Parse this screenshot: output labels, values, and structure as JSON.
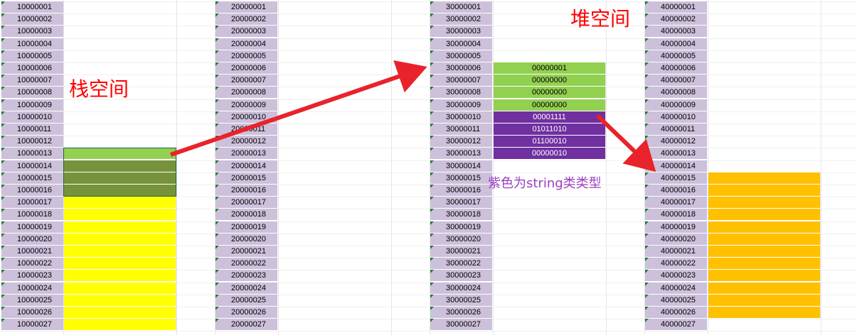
{
  "columns": [
    {
      "id": "stack-addr",
      "addresses": [
        "10000001",
        "10000002",
        "10000003",
        "10000004",
        "10000005",
        "10000006",
        "10000007",
        "10000008",
        "10000009",
        "10000010",
        "10000011",
        "10000012",
        "10000013",
        "10000014",
        "10000015",
        "10000016",
        "10000017",
        "10000018",
        "10000019",
        "10000020",
        "10000021",
        "10000022",
        "10000023",
        "10000024",
        "10000025",
        "10000026",
        "10000027"
      ]
    },
    {
      "id": "col2-addr",
      "addresses": [
        "20000001",
        "20000002",
        "20000003",
        "20000004",
        "20000005",
        "20000006",
        "20000007",
        "20000008",
        "20000009",
        "20000010",
        "20000011",
        "20000012",
        "20000013",
        "20000014",
        "20000015",
        "20000016",
        "20000017",
        "20000018",
        "20000019",
        "20000020",
        "20000021",
        "20000022",
        "20000023",
        "20000024",
        "20000025",
        "20000026",
        "20000027"
      ]
    },
    {
      "id": "heap-addr",
      "addresses": [
        "30000001",
        "30000002",
        "30000003",
        "30000004",
        "30000005",
        "30000006",
        "30000007",
        "30000008",
        "30000009",
        "30000010",
        "30000011",
        "30000012",
        "30000013",
        "30000014",
        "30000015",
        "30000016",
        "30000017",
        "30000018",
        "30000019",
        "30000020",
        "30000021",
        "30000022",
        "30000023",
        "30000024",
        "30000025",
        "30000026",
        "30000027"
      ]
    },
    {
      "id": "col4-addr",
      "addresses": [
        "40000001",
        "40000002",
        "40000003",
        "40000004",
        "40000005",
        "40000006",
        "40000007",
        "40000008",
        "40000009",
        "40000010",
        "40000011",
        "40000012",
        "40000013",
        "40000014",
        "40000015",
        "40000016",
        "40000017",
        "40000018",
        "40000019",
        "40000020",
        "40000021",
        "40000022",
        "40000023",
        "40000024",
        "40000025",
        "40000026",
        "40000027"
      ]
    }
  ],
  "heap_values": [
    "00000001",
    "00000000",
    "00000000",
    "00000000",
    "00001111",
    "01011010",
    "01100010",
    "00000010"
  ],
  "labels": {
    "stack": "栈空间",
    "heap": "堆空间",
    "purple_note": "紫色为string类类型"
  },
  "colors": {
    "addr_bg": "#ccc0da",
    "light_green": "#92d050",
    "dark_green": "#76933c",
    "yellow": "#ffff00",
    "purple": "#7030a0",
    "orange": "#ffc000",
    "label_red": "#ff0000",
    "label_purple": "#9b3fc0",
    "arrow_red": "#e8232b"
  }
}
